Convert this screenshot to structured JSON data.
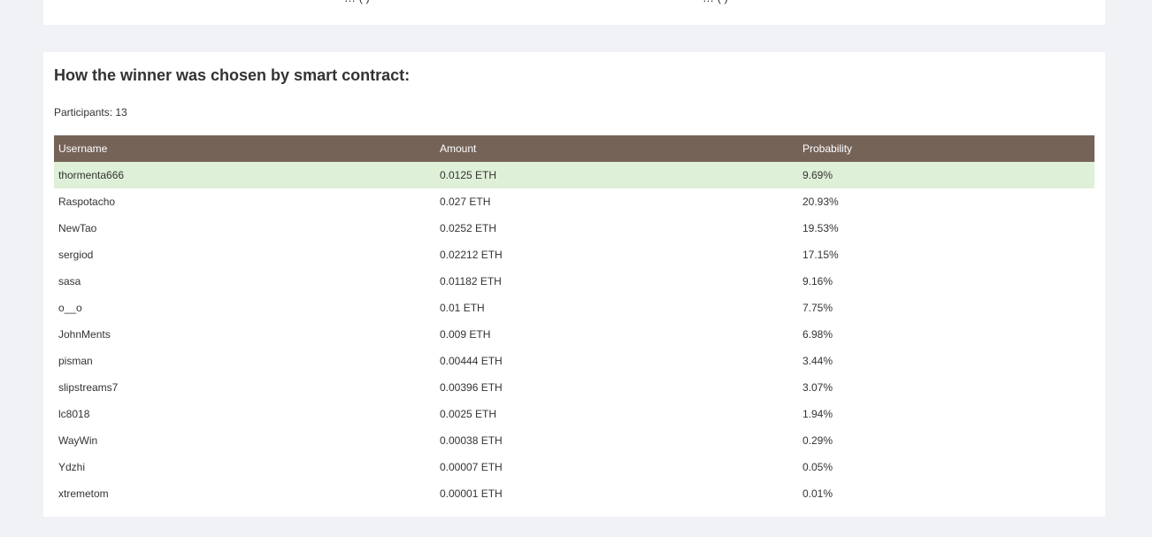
{
  "top_card": {
    "left_fragment": "… ( )",
    "right_fragment": "… ( )"
  },
  "section": {
    "title": "How the winner was chosen by smart contract:",
    "participants_label": "Participants: 13"
  },
  "table": {
    "headers": {
      "username": "Username",
      "amount": "Amount",
      "probability": "Probability"
    },
    "rows": [
      {
        "username": "thormenta666",
        "amount": "0.0125 ETH",
        "probability": "9.69%",
        "winner": true
      },
      {
        "username": "Raspotacho",
        "amount": "0.027 ETH",
        "probability": "20.93%"
      },
      {
        "username": "NewTao",
        "amount": "0.0252 ETH",
        "probability": "19.53%"
      },
      {
        "username": "sergiod",
        "amount": "0.02212 ETH",
        "probability": "17.15%"
      },
      {
        "username": "sasa",
        "amount": "0.01182 ETH",
        "probability": "9.16%"
      },
      {
        "username": "o__o",
        "amount": "0.01 ETH",
        "probability": "7.75%"
      },
      {
        "username": "JohnMents",
        "amount": "0.009 ETH",
        "probability": "6.98%"
      },
      {
        "username": "pisman",
        "amount": "0.00444 ETH",
        "probability": "3.44%"
      },
      {
        "username": "slipstreams7",
        "amount": "0.00396 ETH",
        "probability": "3.07%"
      },
      {
        "username": "lc8018",
        "amount": "0.0025 ETH",
        "probability": "1.94%"
      },
      {
        "username": "WayWin",
        "amount": "0.00038 ETH",
        "probability": "0.29%"
      },
      {
        "username": "Ydzhi",
        "amount": "0.00007 ETH",
        "probability": "0.05%"
      },
      {
        "username": "xtremetom",
        "amount": "0.00001 ETH",
        "probability": "0.01%"
      }
    ]
  },
  "colors": {
    "header_bg": "#766358",
    "winner_row_bg": "#dff0d8",
    "page_bg": "#f1f2f6"
  }
}
